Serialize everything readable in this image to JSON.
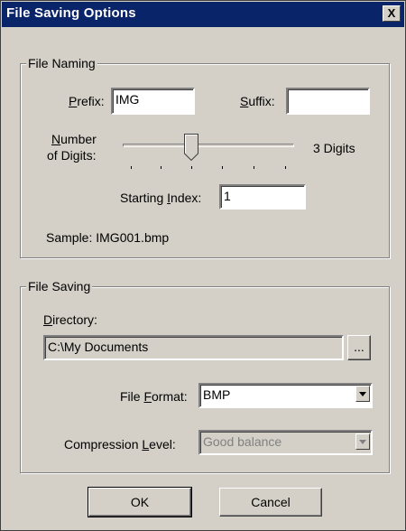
{
  "dialog": {
    "title": "File Saving Options",
    "close_label": "X"
  },
  "file_naming": {
    "group_label": "File Naming",
    "prefix_label": "Prefix:",
    "prefix_value": "IMG",
    "suffix_label": "Suffix:",
    "suffix_value": "",
    "digits_label_line1": "Number",
    "digits_label_line2": "of Digits:",
    "digits_value": "3 Digits",
    "digits_slider": {
      "min": 1,
      "max": 7,
      "value": 3
    },
    "starting_index_label": "Starting Index:",
    "starting_index_value": "1",
    "sample_text": "Sample: IMG001.bmp"
  },
  "file_saving": {
    "group_label": "File Saving",
    "directory_label": "Directory:",
    "directory_value": "C:\\My Documents",
    "browse_label": "...",
    "format_label": "File Format:",
    "format_value": "BMP",
    "compression_label": "Compression Level:",
    "compression_value": "Good balance"
  },
  "buttons": {
    "ok_label": "OK",
    "cancel_label": "Cancel"
  },
  "colors": {
    "title_bar": "#0a246a",
    "face": "#d4d0c8"
  }
}
